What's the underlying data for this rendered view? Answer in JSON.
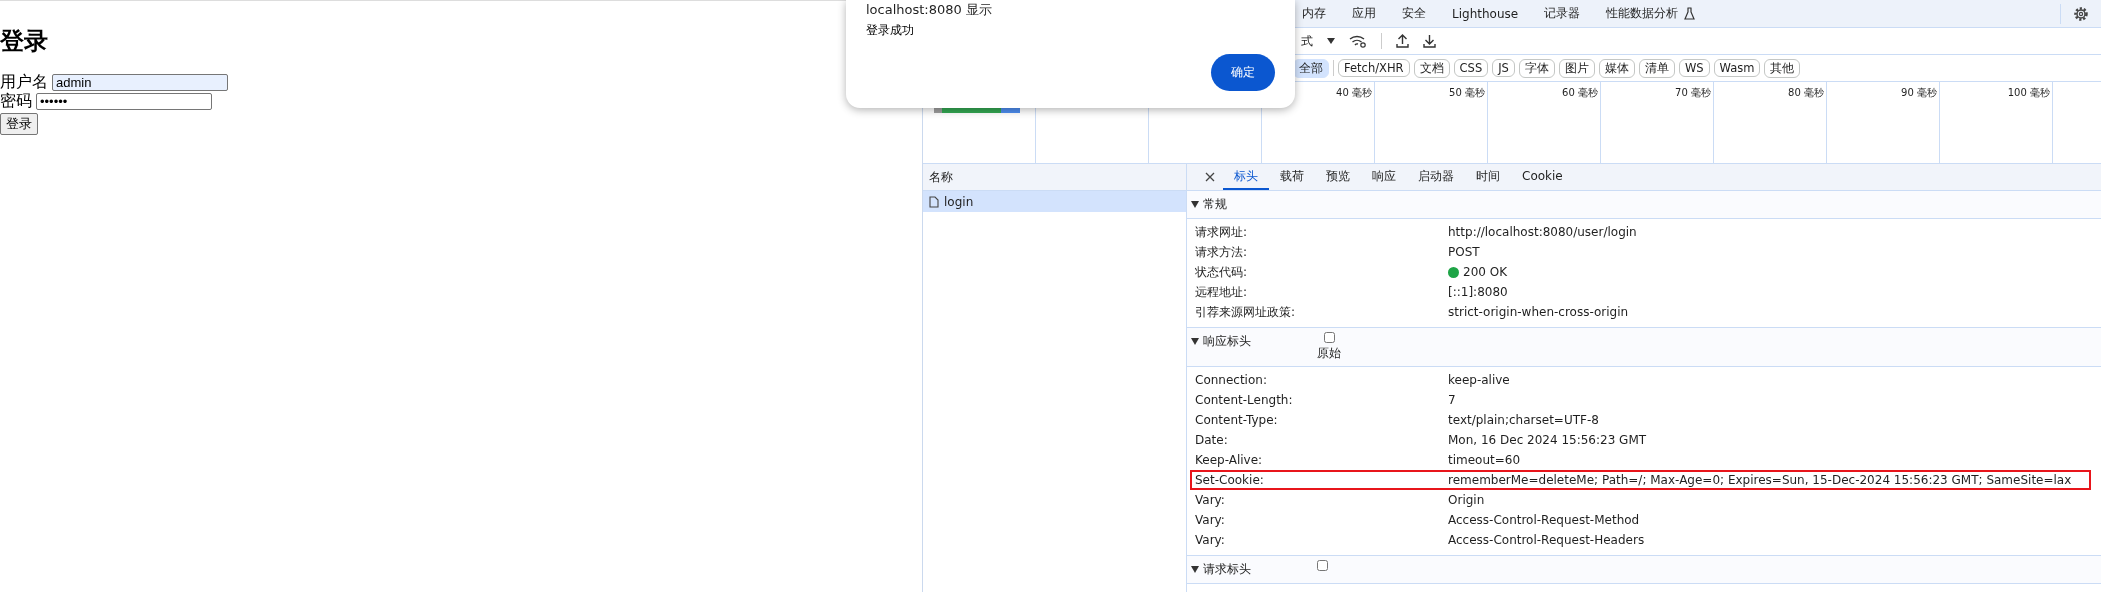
{
  "page": {
    "heading": "登录",
    "fields": [
      {
        "label": "用户名",
        "value": "admin",
        "autofilled": true
      },
      {
        "label": "密码",
        "value": "••••••",
        "autofilled": false
      }
    ],
    "button": "登录"
  },
  "dialog": {
    "title": "localhost:8080 显示",
    "message": "登录成功",
    "button": "确定"
  },
  "devtools": {
    "tabs": [
      {
        "label": "内存",
        "selected": false
      },
      {
        "label": "应用",
        "selected": false
      },
      {
        "label": "安全",
        "selected": false
      },
      {
        "label": "Lighthouse",
        "selected": false
      },
      {
        "label": "记录器",
        "selected": false
      },
      {
        "label": "性能数据分析",
        "selected": false,
        "experimental": true
      }
    ],
    "throttle": "式",
    "filters": [
      {
        "label": "全部",
        "selected": true
      },
      {
        "label": "Fetch/XHR",
        "selected": false
      },
      {
        "label": "文档",
        "selected": false
      },
      {
        "label": "CSS",
        "selected": false
      },
      {
        "label": "JS",
        "selected": false
      },
      {
        "label": "字体",
        "selected": false
      },
      {
        "label": "图片",
        "selected": false
      },
      {
        "label": "媒体",
        "selected": false
      },
      {
        "label": "清单",
        "selected": false
      },
      {
        "label": "WS",
        "selected": false
      },
      {
        "label": "Wasm",
        "selected": false
      },
      {
        "label": "其他",
        "selected": false
      }
    ],
    "timeline_ticks": [
      "40 毫秒",
      "50 毫秒",
      "60 毫秒",
      "70 毫秒",
      "80 毫秒",
      "90 毫秒",
      "100 毫秒"
    ],
    "requests": {
      "column": "名称",
      "items": [
        {
          "name": "login",
          "selected": true
        }
      ]
    },
    "detail_tabs": [
      {
        "label": "标头",
        "selected": true
      },
      {
        "label": "载荷",
        "selected": false
      },
      {
        "label": "预览",
        "selected": false
      },
      {
        "label": "响应",
        "selected": false
      },
      {
        "label": "启动器",
        "selected": false
      },
      {
        "label": "时间",
        "selected": false
      },
      {
        "label": "Cookie",
        "selected": false
      }
    ],
    "sections": [
      {
        "title": "常规",
        "expanded": true,
        "rows": [
          {
            "name": "请求网址:",
            "value": "http://localhost:8080/user/login",
            "kind": "text",
            "highlighted": false
          },
          {
            "name": "请求方法:",
            "value": "POST",
            "kind": "text",
            "highlighted": false
          },
          {
            "name": "状态代码:",
            "value": "200 OK",
            "kind": "status",
            "highlighted": false
          },
          {
            "name": "远程地址:",
            "value": "[::1]:8080",
            "kind": "text",
            "highlighted": false
          },
          {
            "name": "引荐来源网址政策:",
            "value": "strict-origin-when-cross-origin",
            "kind": "text",
            "highlighted": false
          }
        ]
      },
      {
        "title": "响应标头",
        "expanded": true,
        "raw_checked": false,
        "raw_label": "原始",
        "rows": [
          {
            "name": "Connection:",
            "value": "keep-alive",
            "kind": "text",
            "highlighted": false
          },
          {
            "name": "Content-Length:",
            "value": "7",
            "kind": "text",
            "highlighted": false
          },
          {
            "name": "Content-Type:",
            "value": "text/plain;charset=UTF-8",
            "kind": "text",
            "highlighted": false
          },
          {
            "name": "Date:",
            "value": "Mon, 16 Dec 2024 15:56:23 GMT",
            "kind": "text",
            "highlighted": false
          },
          {
            "name": "Keep-Alive:",
            "value": "timeout=60",
            "kind": "text",
            "highlighted": false
          },
          {
            "name": "Set-Cookie:",
            "value": "rememberMe=deleteMe; Path=/; Max-Age=0; Expires=Sun, 15-Dec-2024 15:56:23 GMT; SameSite=lax",
            "kind": "text",
            "highlighted": true
          },
          {
            "name": "Vary:",
            "value": "Origin",
            "kind": "text",
            "highlighted": false
          },
          {
            "name": "Vary:",
            "value": "Access-Control-Request-Method",
            "kind": "text",
            "highlighted": false
          },
          {
            "name": "Vary:",
            "value": "Access-Control-Request-Headers",
            "kind": "text",
            "highlighted": false
          }
        ]
      },
      {
        "title": "请求标头",
        "expanded": true,
        "raw_checked": false
      }
    ]
  }
}
